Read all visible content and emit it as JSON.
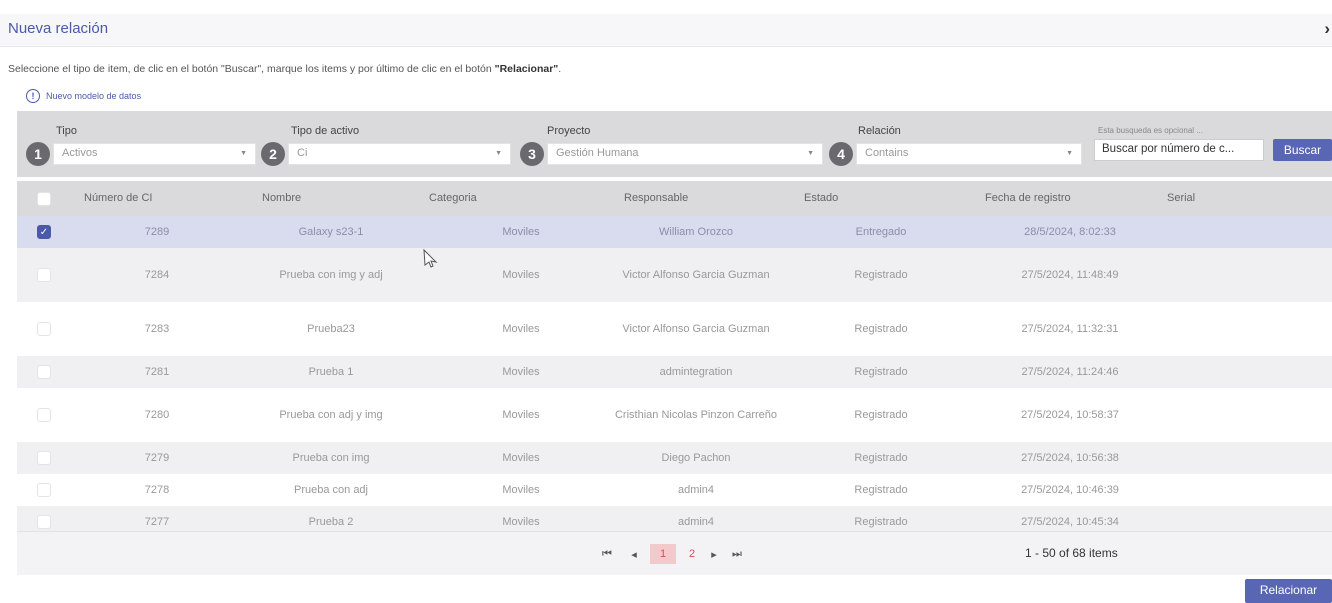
{
  "dialog": {
    "title": "Nueva relación",
    "close_icon": "›"
  },
  "instructions": {
    "part1": "Seleccione el tipo de item, de clic en el botón \"Buscar\", marque los items y por último de clic en el botón ",
    "bold": "\"Relacionar\"",
    "part2": "."
  },
  "new_model_link": "Nuevo modelo de datos",
  "filters": {
    "tipo": {
      "num": "1",
      "label": "Tipo",
      "value": "Activos"
    },
    "tipo_activo": {
      "num": "2",
      "label": "Tipo de activo",
      "value": "Ci"
    },
    "proyecto": {
      "num": "3",
      "label": "Proyecto",
      "value": "Gestión Humana"
    },
    "relacion": {
      "num": "4",
      "label": "Relación",
      "value": "Contains"
    },
    "optional_note": "Esta busqueda es opcional ...",
    "search_value": "Buscar por número de c...",
    "search_button": "Buscar"
  },
  "table": {
    "headers": [
      "Número de CI",
      "Nombre",
      "Categoria",
      "Responsable",
      "Estado",
      "Fecha de registro",
      "Serial"
    ],
    "rows": [
      {
        "id": "7289",
        "nombre": "Galaxy s23-1",
        "categoria": "Moviles",
        "responsable": "William Orozco",
        "estado": "Entregado",
        "fecha": "28/5/2024, 8:02:33",
        "serial": "",
        "checked": true
      },
      {
        "id": "7284",
        "nombre": "Prueba con img y adj",
        "categoria": "Moviles",
        "responsable": "Victor Alfonso Garcia Guzman",
        "estado": "Registrado",
        "fecha": "27/5/2024, 11:48:49",
        "serial": "",
        "checked": false
      },
      {
        "id": "7283",
        "nombre": "Prueba23",
        "categoria": "Moviles",
        "responsable": "Victor Alfonso Garcia Guzman",
        "estado": "Registrado",
        "fecha": "27/5/2024, 11:32:31",
        "serial": "",
        "checked": false
      },
      {
        "id": "7281",
        "nombre": "Prueba 1",
        "categoria": "Moviles",
        "responsable": "admintegration",
        "estado": "Registrado",
        "fecha": "27/5/2024, 11:24:46",
        "serial": "",
        "checked": false
      },
      {
        "id": "7280",
        "nombre": "Prueba con adj y img",
        "categoria": "Moviles",
        "responsable": "Cristhian Nicolas Pinzon Carreño",
        "estado": "Registrado",
        "fecha": "27/5/2024, 10:58:37",
        "serial": "",
        "checked": false
      },
      {
        "id": "7279",
        "nombre": "Prueba con img",
        "categoria": "Moviles",
        "responsable": "Diego Pachon",
        "estado": "Registrado",
        "fecha": "27/5/2024, 10:56:38",
        "serial": "",
        "checked": false
      },
      {
        "id": "7278",
        "nombre": "Prueba con adj",
        "categoria": "Moviles",
        "responsable": "admin4",
        "estado": "Registrado",
        "fecha": "27/5/2024, 10:46:39",
        "serial": "",
        "checked": false
      },
      {
        "id": "7277",
        "nombre": "Prueba 2",
        "categoria": "Moviles",
        "responsable": "admin4",
        "estado": "Registrado",
        "fecha": "27/5/2024, 10:45:34",
        "serial": "",
        "checked": false
      }
    ]
  },
  "pager": {
    "first": "⏮",
    "prev": "◂",
    "pages": [
      "1",
      "2"
    ],
    "next": "▸",
    "last": "⏭",
    "items": "1 - 50 of 68 items"
  },
  "relate_button": "Relacionar",
  "colors": {
    "accent": "#5866b4",
    "selected_row": "#d9dcef",
    "odd_row": "#f0f0f2",
    "active_page": "#f4c9cb"
  }
}
